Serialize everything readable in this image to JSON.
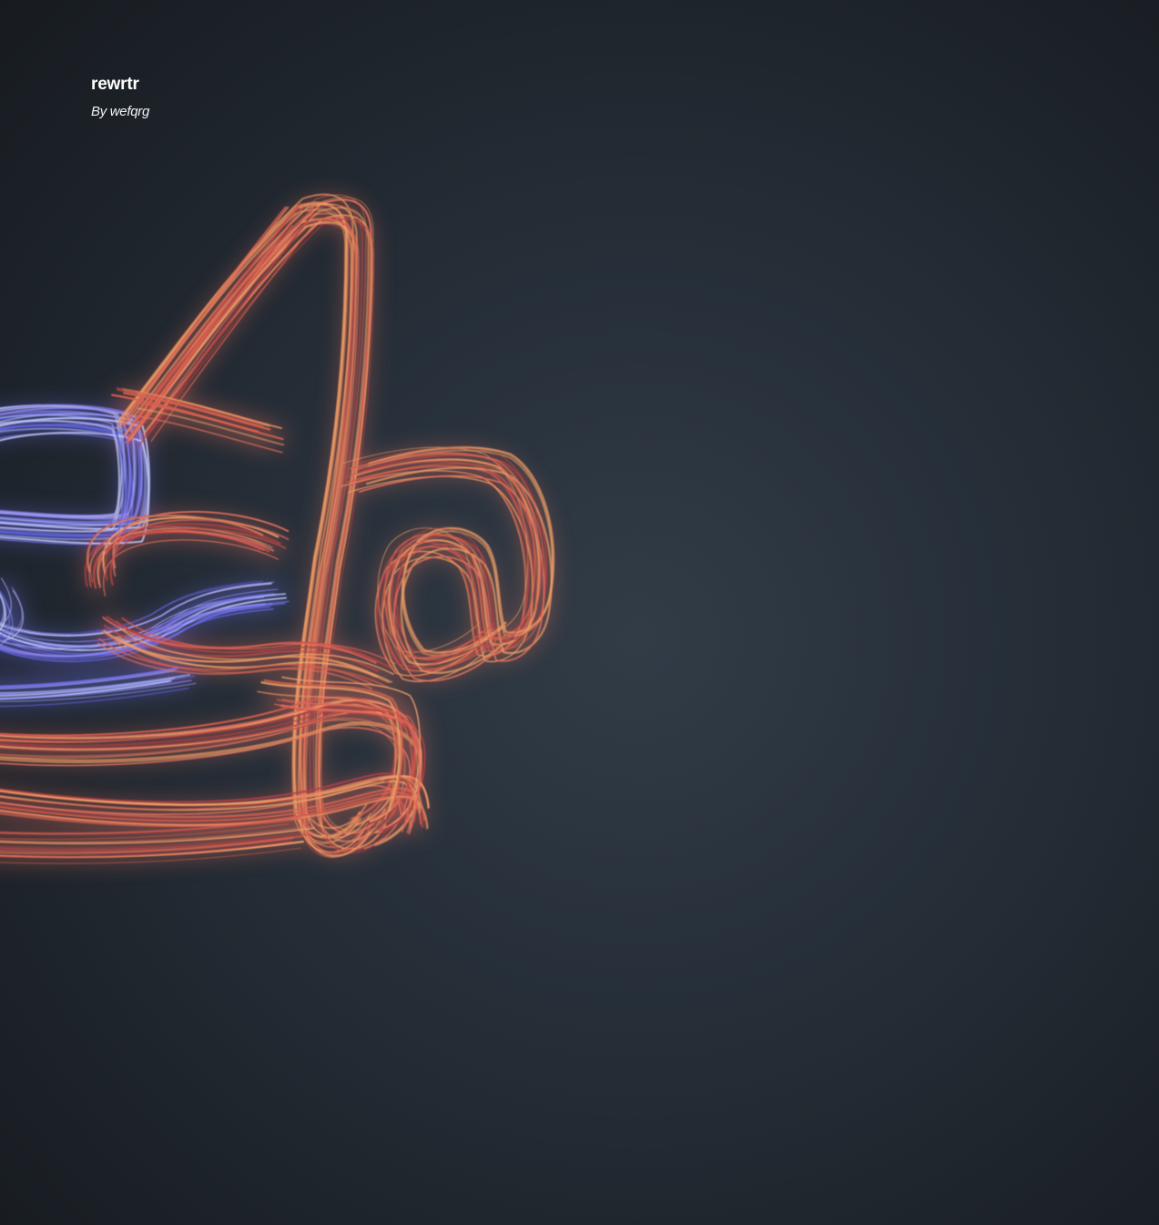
{
  "artwork": {
    "title": "rewrtr",
    "byline": "By wefqrg"
  },
  "colors": {
    "background_center": "#323c47",
    "background_edge": "#171b20",
    "warm_strokes": [
      "#e0705e",
      "#d9614f",
      "#ef9a62",
      "#c94a4a",
      "#f0a56a",
      "#b23f45"
    ],
    "cool_strokes": [
      "#6f6fe8",
      "#8f86f2",
      "#a9b4f5",
      "#5a5fd9",
      "#c7cdf7"
    ],
    "text": "#ffffff"
  }
}
